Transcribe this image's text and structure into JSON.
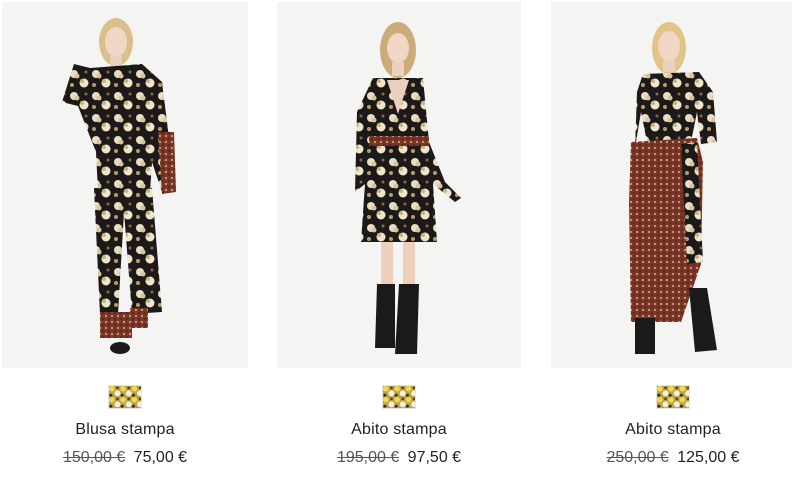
{
  "products": [
    {
      "name": "Blusa stampa",
      "old_price": "150,00 €",
      "price": "75,00 €",
      "image_icon": "model-floral-blouse-trousers-photo",
      "swatch_icon": "floral-print-swatch"
    },
    {
      "name": "Abito stampa",
      "old_price": "195,00 €",
      "price": "97,50 €",
      "image_icon": "model-floral-dress-photo",
      "swatch_icon": "floral-print-swatch"
    },
    {
      "name": "Abito stampa",
      "old_price": "250,00 €",
      "price": "125,00 €",
      "image_icon": "model-floral-dress-skirt-photo",
      "swatch_icon": "floral-print-swatch"
    }
  ],
  "colors": {
    "photo_bg": "#f4f4f3",
    "fabric_black": "#1c1a18",
    "floral_cream": "#e8dcc0",
    "rust_print": "#7a3526",
    "text": "#222222"
  }
}
